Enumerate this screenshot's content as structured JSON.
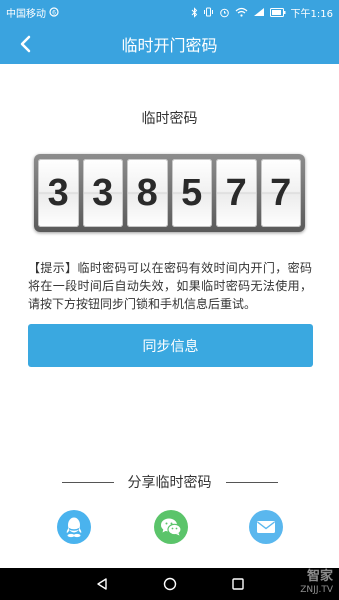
{
  "status_bar": {
    "carrier": "中国移动",
    "time": "下午1:16"
  },
  "header": {
    "title": "临时开门密码"
  },
  "code_section": {
    "label": "临时密码",
    "digits": [
      "3",
      "3",
      "8",
      "5",
      "7",
      "7"
    ]
  },
  "tip_text": "【提示】临时密码可以在密码有效时间内开门，密码将在一段时间后自动失效，如果临时密码无法使用，请按下方按钮同步门锁和手机信息后重试。",
  "sync_button_label": "同步信息",
  "share": {
    "title": "分享临时密码",
    "icons": [
      "qq-icon",
      "wechat-icon",
      "email-icon"
    ]
  },
  "watermark": {
    "line1": "智家",
    "line2": "ZNJJ.TV"
  },
  "colors": {
    "primary": "#3aa3df",
    "button": "#3aa8e0",
    "qq": "#4ab3ee",
    "wechat": "#5bc46a",
    "email": "#5ab7ee"
  }
}
